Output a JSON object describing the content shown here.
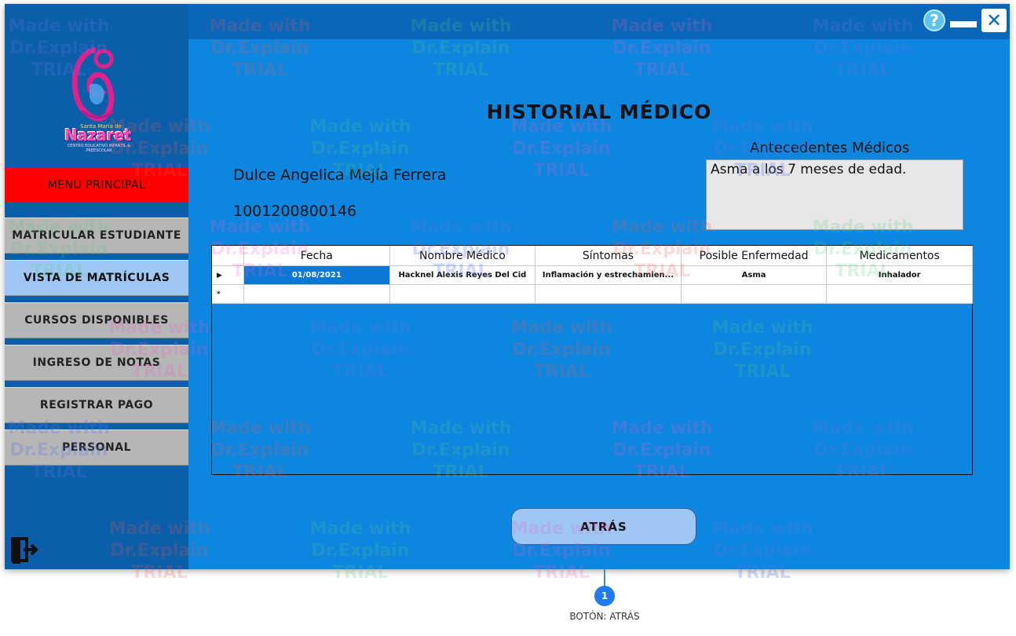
{
  "sidebar": {
    "logo": {
      "top_text": "Santa María de",
      "name": "Nazaret",
      "sub_text": "CENTRO EDUCATIVO INFANTIL & PREESCOLAR"
    },
    "menu_header": "MENU PRINCIPAL",
    "items": [
      {
        "label": "MATRICULAR ESTUDIANTE"
      },
      {
        "label": "VISTA DE MATRÍCULAS"
      },
      {
        "label": "CURSOS DISPONIBLES"
      },
      {
        "label": "INGRESO DE NOTAS"
      },
      {
        "label": "REGISTRAR PAGO"
      },
      {
        "label": "PERSONAL"
      }
    ],
    "exit_icon": "exit-icon"
  },
  "window_controls": {
    "help": "?",
    "minimize": "—",
    "close": "✕"
  },
  "main": {
    "title": "HISTORIAL MÉDICO",
    "patient_name": "Dulce Angelica Mejía Ferrera",
    "patient_id": "1001200800146",
    "antecedentes": {
      "label": "Antecedentes Médicos",
      "value": "Asma a los 7 meses de edad."
    },
    "grid": {
      "columns": [
        "Fecha",
        "Nombre Médico",
        "Síntomas",
        "Posible Enfermedad",
        "Medicamentos"
      ],
      "rows": [
        {
          "marker": "▶",
          "cells": [
            "01/08/2021",
            "Hacknel Alexis Reyes Del Cid",
            "Inflamación y estrechamien...",
            "Asma",
            "Inhalador"
          ]
        },
        {
          "marker": "*",
          "cells": [
            "",
            "",
            "",
            "",
            ""
          ]
        }
      ]
    },
    "back_button": "ATRÁS"
  },
  "callout": {
    "number": "1",
    "label": "BOTÓN: ATRÁS"
  },
  "watermark": {
    "line1": "Made with",
    "line2": "Dr.Explain",
    "line3": "TRIAL"
  }
}
